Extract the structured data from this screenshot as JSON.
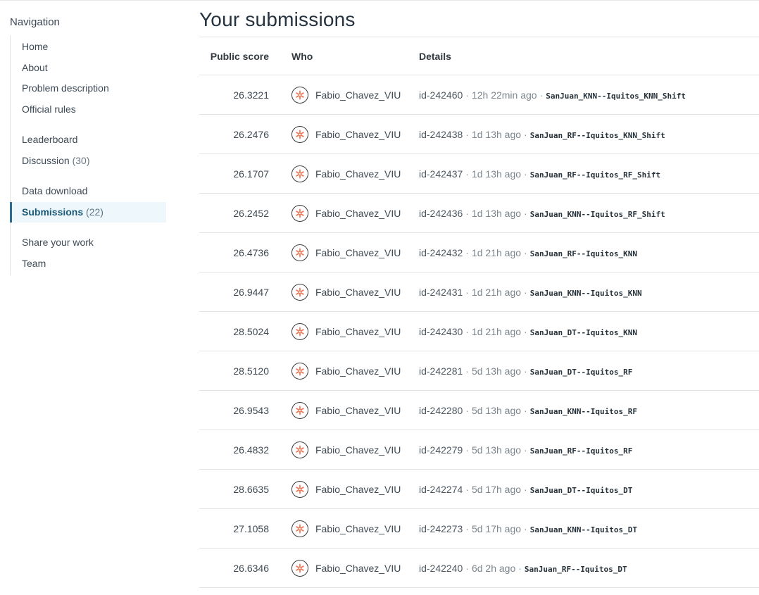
{
  "navigation": {
    "heading": "Navigation",
    "groups": [
      [
        {
          "label": "Home",
          "count": "",
          "active": false
        },
        {
          "label": "About",
          "count": "",
          "active": false
        },
        {
          "label": "Problem description",
          "count": "",
          "active": false
        },
        {
          "label": "Official rules",
          "count": "",
          "active": false
        }
      ],
      [
        {
          "label": "Leaderboard",
          "count": "",
          "active": false
        },
        {
          "label": "Discussion",
          "count": "(30)",
          "active": false
        }
      ],
      [
        {
          "label": "Data download",
          "count": "",
          "active": false
        },
        {
          "label": "Submissions",
          "count": "(22)",
          "active": true
        }
      ],
      [
        {
          "label": "Share your work",
          "count": "",
          "active": false
        },
        {
          "label": "Team",
          "count": "",
          "active": false
        }
      ]
    ]
  },
  "main": {
    "title": "Your submissions",
    "columns": {
      "score": "Public score",
      "who": "Who",
      "details": "Details"
    },
    "rows": [
      {
        "score": "26.3221",
        "who": "Fabio_Chavez_VIU",
        "id": "id-242460",
        "ago": "12h 22min ago",
        "desc": "SanJuan_KNN--Iquitos_KNN_Shift"
      },
      {
        "score": "26.2476",
        "who": "Fabio_Chavez_VIU",
        "id": "id-242438",
        "ago": "1d 13h ago",
        "desc": "SanJuan_RF--Iquitos_KNN_Shift"
      },
      {
        "score": "26.1707",
        "who": "Fabio_Chavez_VIU",
        "id": "id-242437",
        "ago": "1d 13h ago",
        "desc": "SanJuan_RF--Iquitos_RF_Shift"
      },
      {
        "score": "26.2452",
        "who": "Fabio_Chavez_VIU",
        "id": "id-242436",
        "ago": "1d 13h ago",
        "desc": "SanJuan_KNN--Iquitos_RF_Shift"
      },
      {
        "score": "26.4736",
        "who": "Fabio_Chavez_VIU",
        "id": "id-242432",
        "ago": "1d 21h ago",
        "desc": "SanJuan_RF--Iquitos_KNN"
      },
      {
        "score": "26.9447",
        "who": "Fabio_Chavez_VIU",
        "id": "id-242431",
        "ago": "1d 21h ago",
        "desc": "SanJuan_KNN--Iquitos_KNN"
      },
      {
        "score": "28.5024",
        "who": "Fabio_Chavez_VIU",
        "id": "id-242430",
        "ago": "1d 21h ago",
        "desc": "SanJuan_DT--Iquitos_KNN"
      },
      {
        "score": "28.5120",
        "who": "Fabio_Chavez_VIU",
        "id": "id-242281",
        "ago": "5d 13h ago",
        "desc": "SanJuan_DT--Iquitos_RF"
      },
      {
        "score": "26.9543",
        "who": "Fabio_Chavez_VIU",
        "id": "id-242280",
        "ago": "5d 13h ago",
        "desc": "SanJuan_KNN--Iquitos_RF"
      },
      {
        "score": "26.4832",
        "who": "Fabio_Chavez_VIU",
        "id": "id-242279",
        "ago": "5d 13h ago",
        "desc": "SanJuan_RF--Iquitos_RF"
      },
      {
        "score": "28.6635",
        "who": "Fabio_Chavez_VIU",
        "id": "id-242274",
        "ago": "5d 17h ago",
        "desc": "SanJuan_DT--Iquitos_DT"
      },
      {
        "score": "27.1058",
        "who": "Fabio_Chavez_VIU",
        "id": "id-242273",
        "ago": "5d 17h ago",
        "desc": "SanJuan_KNN--Iquitos_DT"
      },
      {
        "score": "26.6346",
        "who": "Fabio_Chavez_VIU",
        "id": "id-242240",
        "ago": "6d 2h ago",
        "desc": "SanJuan_RF--Iquitos_DT"
      }
    ]
  },
  "icons": {
    "avatar": "asterisk-avatar-icon"
  },
  "colors": {
    "accent": "#2a6e8e",
    "active_bg": "#eef7fb",
    "avatar_glyph": "#f07a5a"
  }
}
